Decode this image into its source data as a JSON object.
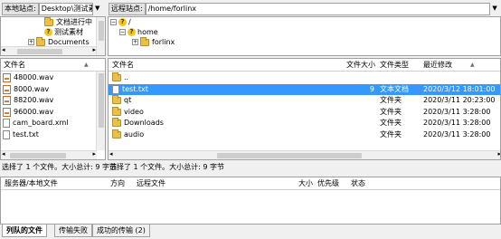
{
  "local": {
    "site_label": "本地站点:",
    "site_path": "Desktop\\测试素材\\",
    "tree": [
      {
        "label": "文档进行中"
      },
      {
        "label": "测试素材"
      },
      {
        "label": "Documents"
      }
    ],
    "columns": {
      "name": "文件名"
    },
    "files": [
      {
        "name": "48000.wav",
        "type": "wav"
      },
      {
        "name": "8000.wav",
        "type": "wav"
      },
      {
        "name": "88200.wav",
        "type": "wav"
      },
      {
        "name": "96000.wav",
        "type": "wav"
      },
      {
        "name": "cam_board.xml",
        "type": "file"
      },
      {
        "name": "test.txt",
        "type": "file"
      }
    ],
    "status": "选择了 1 个文件。大小总计: 9 字节"
  },
  "remote": {
    "site_label": "远程站点:",
    "site_path": "/home/forlinx",
    "tree": [
      {
        "label": "/"
      },
      {
        "label": "home"
      },
      {
        "label": "forlinx"
      }
    ],
    "columns": {
      "name": "文件名",
      "size": "文件大小",
      "type": "文件类型",
      "modified": "最近修改"
    },
    "files": [
      {
        "name": "..",
        "size": "",
        "type": "",
        "modified": "",
        "kind": "folder",
        "selected": false
      },
      {
        "name": "test.txt",
        "size": "9",
        "type": "文本文档",
        "modified": "2020/3/12 18:01:00",
        "kind": "file",
        "selected": true
      },
      {
        "name": "qt",
        "size": "",
        "type": "文件夹",
        "modified": "2020/3/11 20:23:00",
        "kind": "folder",
        "selected": false
      },
      {
        "name": "video",
        "size": "",
        "type": "文件夹",
        "modified": "2020/3/11 3:28:00",
        "kind": "folder",
        "selected": false
      },
      {
        "name": "Downloads",
        "size": "",
        "type": "文件夹",
        "modified": "2020/3/11 3:28:00",
        "kind": "folder",
        "selected": false
      },
      {
        "name": "audio",
        "size": "",
        "type": "文件夹",
        "modified": "2020/3/11 3:28:00",
        "kind": "folder",
        "selected": false
      }
    ],
    "status": "选择了 1 个文件。大小总计: 9 字节"
  },
  "queue": {
    "columns": {
      "server_local": "服务器/本地文件",
      "direction": "方向",
      "remote_file": "远程文件",
      "size": "大小",
      "priority": "优先级",
      "status": "状态"
    }
  },
  "tabs": [
    {
      "label": "列队的文件",
      "active": true
    },
    {
      "label": "传输失败",
      "active": false
    },
    {
      "label": "成功的传输 (2)",
      "active": false
    }
  ],
  "colors": {
    "selection": "#3399ff",
    "folder": "#e8c04a"
  },
  "icons": {
    "sort": "sort-arrow-icon",
    "dropdown": "chevron-down-icon",
    "scroll_left": "chevron-left-icon",
    "scroll_right": "chevron-right-icon",
    "scroll_thumb": "grip-icon",
    "expand": "plus-icon",
    "collapse": "minus-icon"
  }
}
